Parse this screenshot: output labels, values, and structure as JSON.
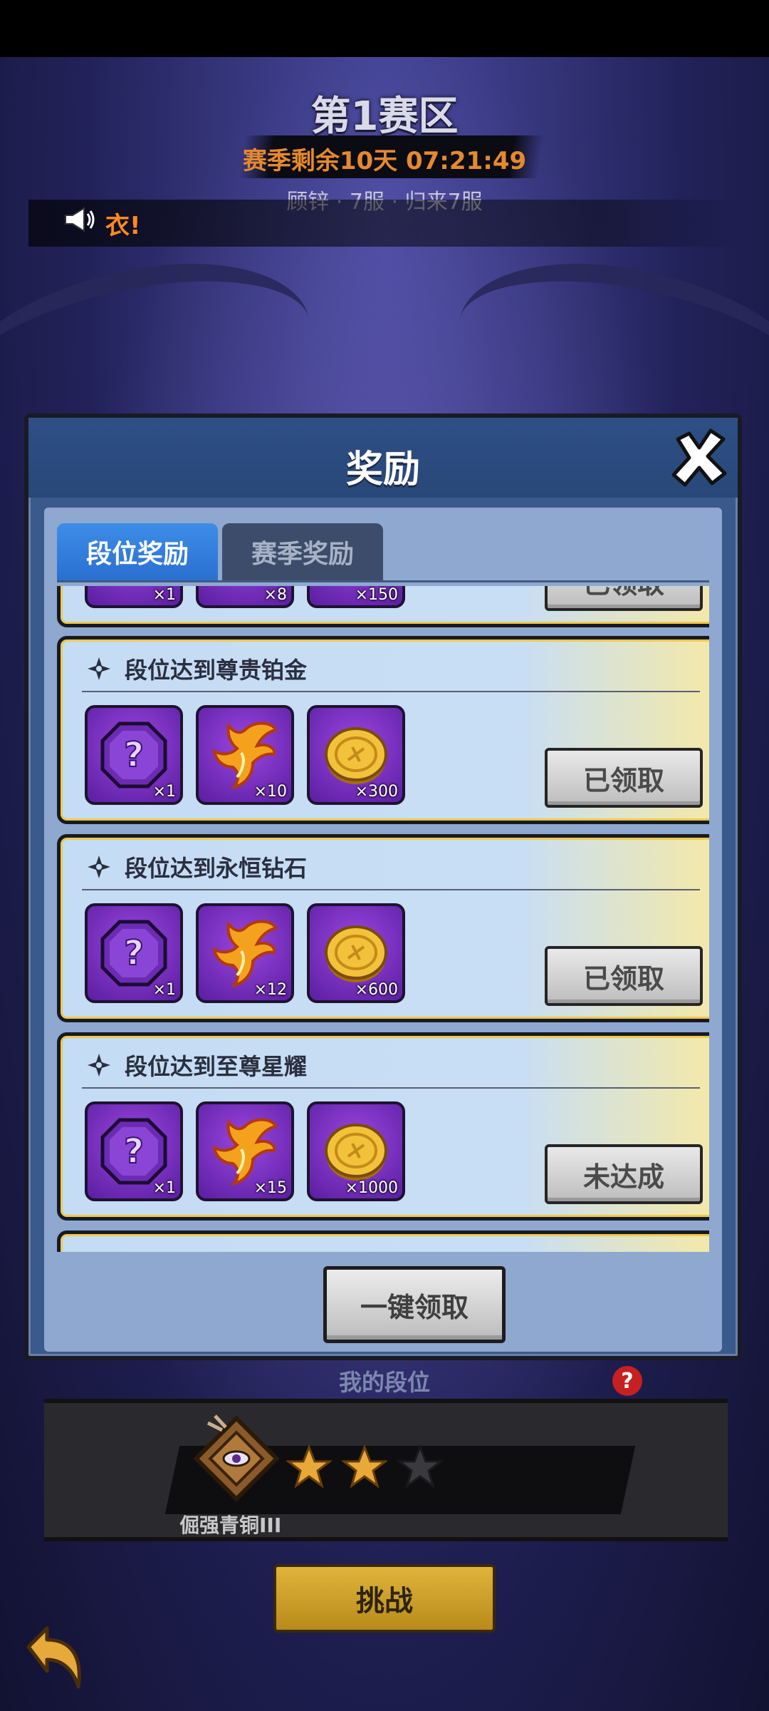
{
  "header": {
    "zone_title": "第1赛区",
    "season_remaining": "赛季剩余10天 07:21:49",
    "server_info": "顾锌 · 7服 · 归来7服"
  },
  "broadcast": {
    "message": "衣!"
  },
  "modal": {
    "title": "奖励",
    "tabs": [
      {
        "label": "段位奖励",
        "active": true
      },
      {
        "label": "赛季奖励",
        "active": false
      }
    ],
    "partial_card": {
      "items": [
        {
          "icon": "mystery-chest-icon",
          "qty": "×1"
        },
        {
          "icon": "phoenix-feather-icon",
          "qty": "×8"
        },
        {
          "icon": "gold-coin-icon",
          "qty": "×150"
        }
      ],
      "status": "已领取"
    },
    "cards": [
      {
        "title": "段位达到尊贵铂金",
        "items": [
          {
            "icon": "mystery-chest-icon",
            "qty": "×1"
          },
          {
            "icon": "phoenix-feather-icon",
            "qty": "×10"
          },
          {
            "icon": "gold-coin-icon",
            "qty": "×300"
          }
        ],
        "status": "已领取"
      },
      {
        "title": "段位达到永恒钻石",
        "items": [
          {
            "icon": "mystery-chest-icon",
            "qty": "×1"
          },
          {
            "icon": "phoenix-feather-icon",
            "qty": "×12"
          },
          {
            "icon": "gold-coin-icon",
            "qty": "×600"
          }
        ],
        "status": "已领取"
      },
      {
        "title": "段位达到至尊星耀",
        "items": [
          {
            "icon": "mystery-chest-icon",
            "qty": "×1"
          },
          {
            "icon": "phoenix-feather-icon",
            "qty": "×15"
          },
          {
            "icon": "gold-coin-icon",
            "qty": "×1000"
          }
        ],
        "status": "未达成"
      }
    ],
    "claim_all_label": "一键领取"
  },
  "my_rank": {
    "header": "我的段位",
    "help": "?",
    "rank_name": "倔强青铜III",
    "stars_filled": 2,
    "stars_total": 3
  },
  "challenge_label": "挑战",
  "colors": {
    "accent_orange": "#e5892e",
    "tab_active": "#2a6fd0",
    "card_border_gold": "#f0c94c",
    "item_purple": "#7a34c8",
    "challenge_gold": "#d2a22c"
  }
}
